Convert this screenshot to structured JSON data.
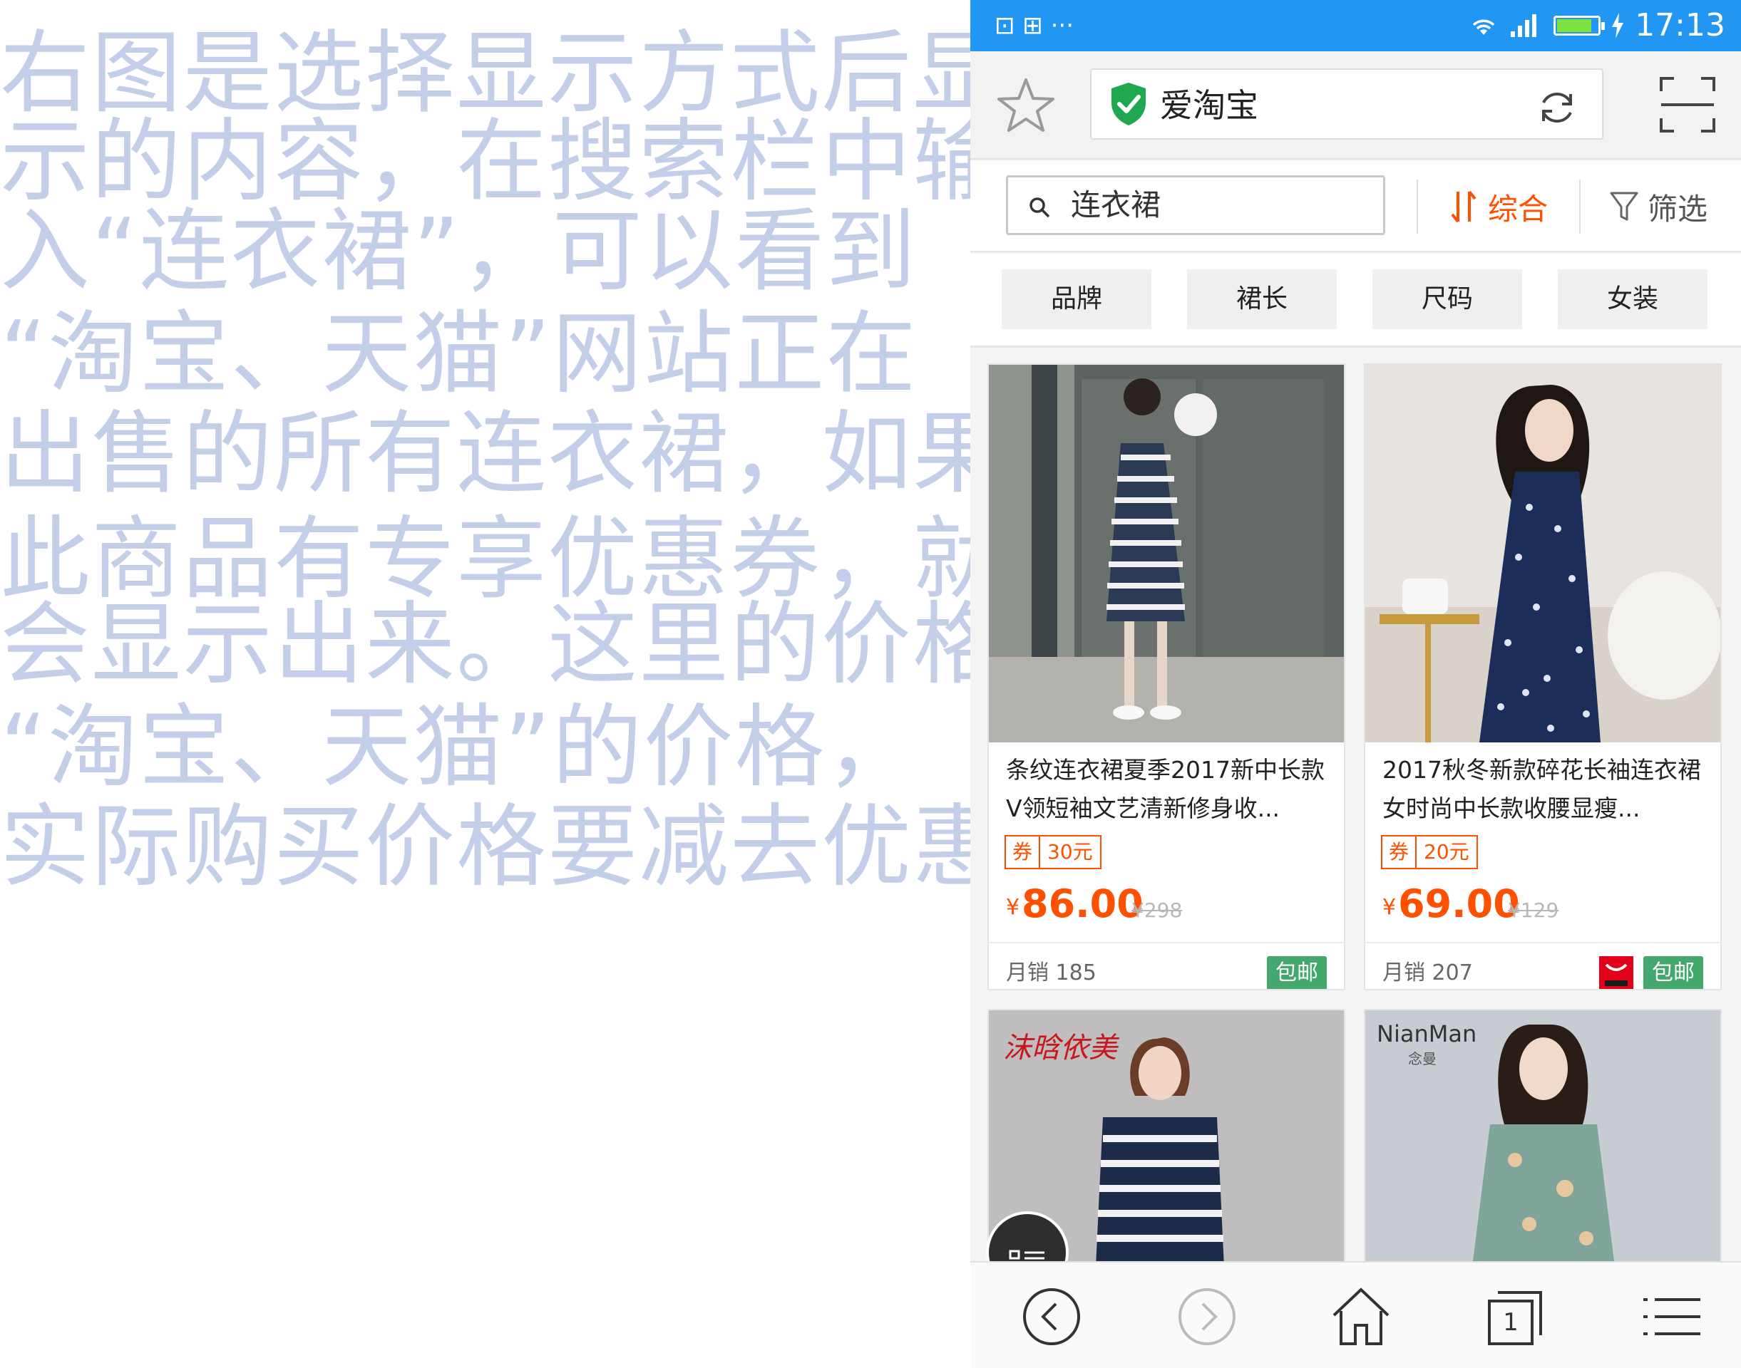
{
  "caption": {
    "lines": [
      "右图是选择显示方式后显",
      "示的内容，在搜索栏中输",
      "入“连衣裙”，可以看到",
      "“淘宝、天猫”网站正在",
      "出售的所有连衣裙，如果",
      "此商品有专享优惠券，就",
      "会显示出来。这里的价格",
      "“淘宝、天猫”的价格，",
      "实际购买价格要减去优惠券"
    ]
  },
  "status_bar": {
    "time": "17:13",
    "left_glyphs": "⊡ ⊞ ···",
    "battery_level": 0.85
  },
  "browser": {
    "site_title": "爱淘宝"
  },
  "search": {
    "query": "连衣裙",
    "sort_label": "综合",
    "filter_label": "筛选"
  },
  "chips": [
    "品牌",
    "裙长",
    "尺码",
    "女装"
  ],
  "products": [
    {
      "title": "条纹连衣裙夏季2017新中长款V领短袖文艺清新修身收...",
      "coupon_label": "券",
      "coupon_value": "30元",
      "currency": "¥",
      "price": "86.00",
      "original_price": "¥298",
      "sales": "月销 185",
      "shipping": "包邮"
    },
    {
      "title": "2017秋冬新款碎花长袖连衣裙女时尚中长款收腰显瘦...",
      "coupon_label": "券",
      "coupon_value": "20元",
      "currency": "¥",
      "price": "69.00",
      "original_price": "¥129",
      "sales": "月销 207",
      "shipping": "包邮"
    }
  ],
  "product_images": {
    "brand_left": "沫晗依美",
    "brand_right": "NianMan",
    "brand_right_sub": "念曼"
  },
  "bottom_nav": {
    "tab_count": "1"
  },
  "colors": {
    "status_bar": "#2196f3",
    "accent": "#ff5000",
    "free_shipping": "#43a86c",
    "caption_text": "#c3cfe8"
  }
}
